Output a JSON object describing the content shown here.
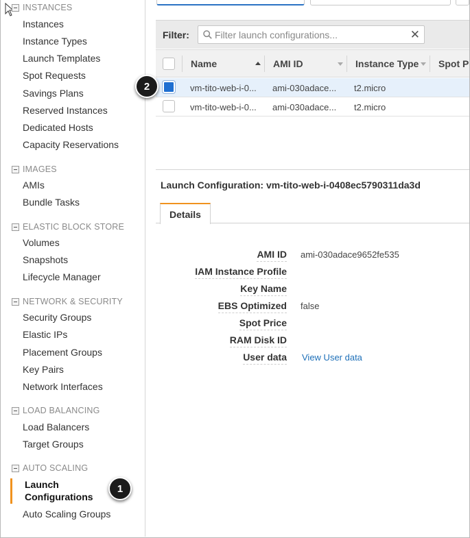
{
  "sidebar": {
    "groups": [
      {
        "title": "INSTANCES",
        "items": [
          "Instances",
          "Instance Types",
          "Launch Templates",
          "Spot Requests",
          "Savings Plans",
          "Reserved Instances",
          "Dedicated Hosts",
          "Capacity Reservations"
        ]
      },
      {
        "title": "IMAGES",
        "items": [
          "AMIs",
          "Bundle Tasks"
        ]
      },
      {
        "title": "ELASTIC BLOCK STORE",
        "items": [
          "Volumes",
          "Snapshots",
          "Lifecycle Manager"
        ]
      },
      {
        "title": "NETWORK & SECURITY",
        "items": [
          "Security Groups",
          "Elastic IPs",
          "Placement Groups",
          "Key Pairs",
          "Network Interfaces"
        ]
      },
      {
        "title": "LOAD BALANCING",
        "items": [
          "Load Balancers",
          "Target Groups"
        ]
      },
      {
        "title": "AUTO SCALING",
        "active_line1": "Launch",
        "active_line2": "Configurations",
        "after_active": "Auto Scaling Groups"
      }
    ]
  },
  "callouts": {
    "step1": "1",
    "step2": "2"
  },
  "filter": {
    "label": "Filter:",
    "placeholder": "Filter launch configurations..."
  },
  "table": {
    "columns": [
      "Name",
      "AMI ID",
      "Instance Type",
      "Spot P"
    ],
    "rows": [
      {
        "name": "vm-tito-web-i-0...",
        "ami_id": "ami-030adace...",
        "instance_type": "t2.micro",
        "selected": true
      },
      {
        "name": "vm-tito-web-i-0...",
        "ami_id": "ami-030adace...",
        "instance_type": "t2.micro",
        "selected": false
      }
    ]
  },
  "details": {
    "title": "Launch Configuration: vm-tito-web-i-0408ec5790311da3d",
    "tab": "Details",
    "fields": [
      {
        "label": "AMI ID",
        "value": "ami-030adace9652fe535"
      },
      {
        "label": "IAM Instance Profile",
        "value": ""
      },
      {
        "label": "Key Name",
        "value": ""
      },
      {
        "label": "EBS Optimized",
        "value": "false"
      },
      {
        "label": "Spot Price",
        "value": ""
      },
      {
        "label": "RAM Disk ID",
        "value": ""
      },
      {
        "label": "User data",
        "value": "View User data"
      }
    ]
  },
  "colors": {
    "accent": "#f0921e",
    "link": "#1d6fb8",
    "selected_row": "#e6f0fb",
    "checkbox": "#1f6fd1"
  }
}
